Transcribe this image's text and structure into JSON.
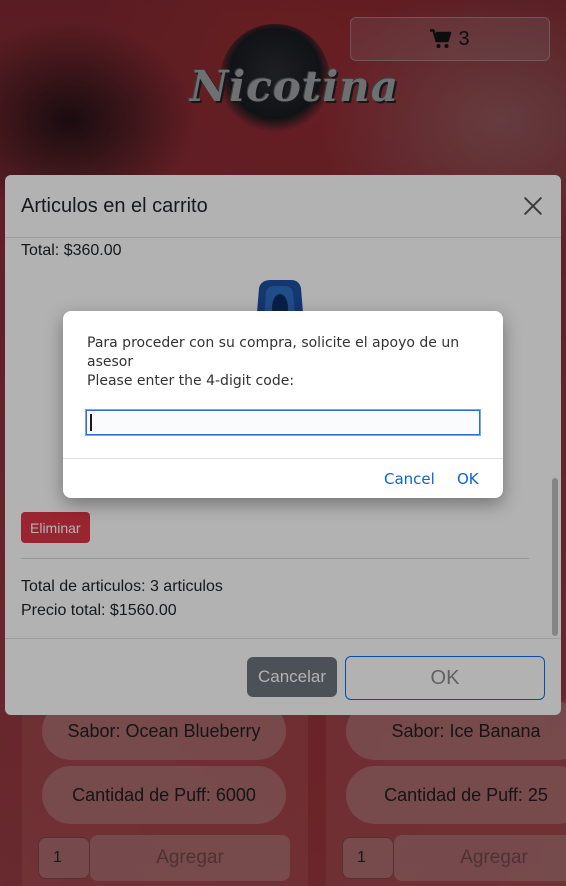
{
  "header": {
    "logo_text": "Nicotina",
    "cart_count": "3"
  },
  "products": [
    {
      "flavor": "Sabor: Ocean Blueberry",
      "puffs": "Cantidad de Puff: 6000",
      "qty": "1",
      "add_label": "Agregar"
    },
    {
      "flavor": "Sabor: Ice Banana",
      "puffs": "Cantidad de Puff: 25",
      "qty": "1",
      "add_label": "Agregar"
    }
  ],
  "cart_modal": {
    "title": "Articulos en el carrito",
    "item_total": "Total: $360.00",
    "delete_label": "Eliminar",
    "total_items": "Total de articulos: 3 articulos",
    "total_price": "Precio total: $1560.00",
    "cancel_label": "Cancelar",
    "ok_label": "OK"
  },
  "prompt": {
    "message_line1": "Para proceder con su compra, solicite el apoyo de un asesor",
    "message_line2": "Please enter the 4-digit code:",
    "input_value": "",
    "cancel_label": "Cancel",
    "ok_label": "OK"
  },
  "colors": {
    "danger": "#dc3545",
    "secondary": "#6c757d",
    "primary_border": "#0d6efd",
    "link_blue": "#0a64d6"
  }
}
